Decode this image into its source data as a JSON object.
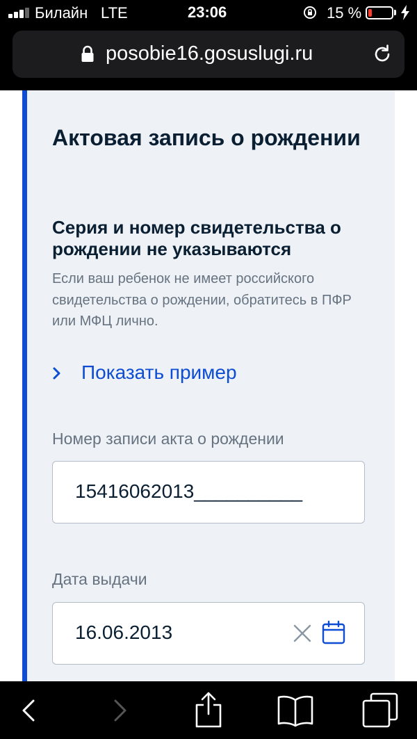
{
  "status_bar": {
    "carrier": "Билайн",
    "network": "LTE",
    "time": "23:06",
    "battery_percent": "15 %",
    "battery_level": 0.15,
    "battery_color": "#ff3b30"
  },
  "browser": {
    "url": "posobie16.gosuslugi.ru",
    "icons": [
      "lock-icon",
      "reload-icon"
    ]
  },
  "form": {
    "section_title": "Актовая запись о рождении",
    "notice_title": "Серия и номер свидетельства о рождении не указываются",
    "notice_text": "Если ваш ребенок не имеет российского свидетельства о рождении, обратитесь в ПФР или МФЦ лично.",
    "show_example_label": "Показать пример",
    "record_number": {
      "label": "Номер записи акта о рождении",
      "value": "15416062013__________"
    },
    "issue_date": {
      "label": "Дата выдачи",
      "value": "16.06.2013"
    }
  },
  "toolbar": {
    "items": [
      "back-icon",
      "forward-icon",
      "share-icon",
      "bookmarks-icon",
      "tabs-icon"
    ]
  },
  "colors": {
    "accent": "#0d4cd3",
    "card_background": "#eef2f7",
    "text_primary": "#0b1f33",
    "text_secondary": "#66727f"
  }
}
